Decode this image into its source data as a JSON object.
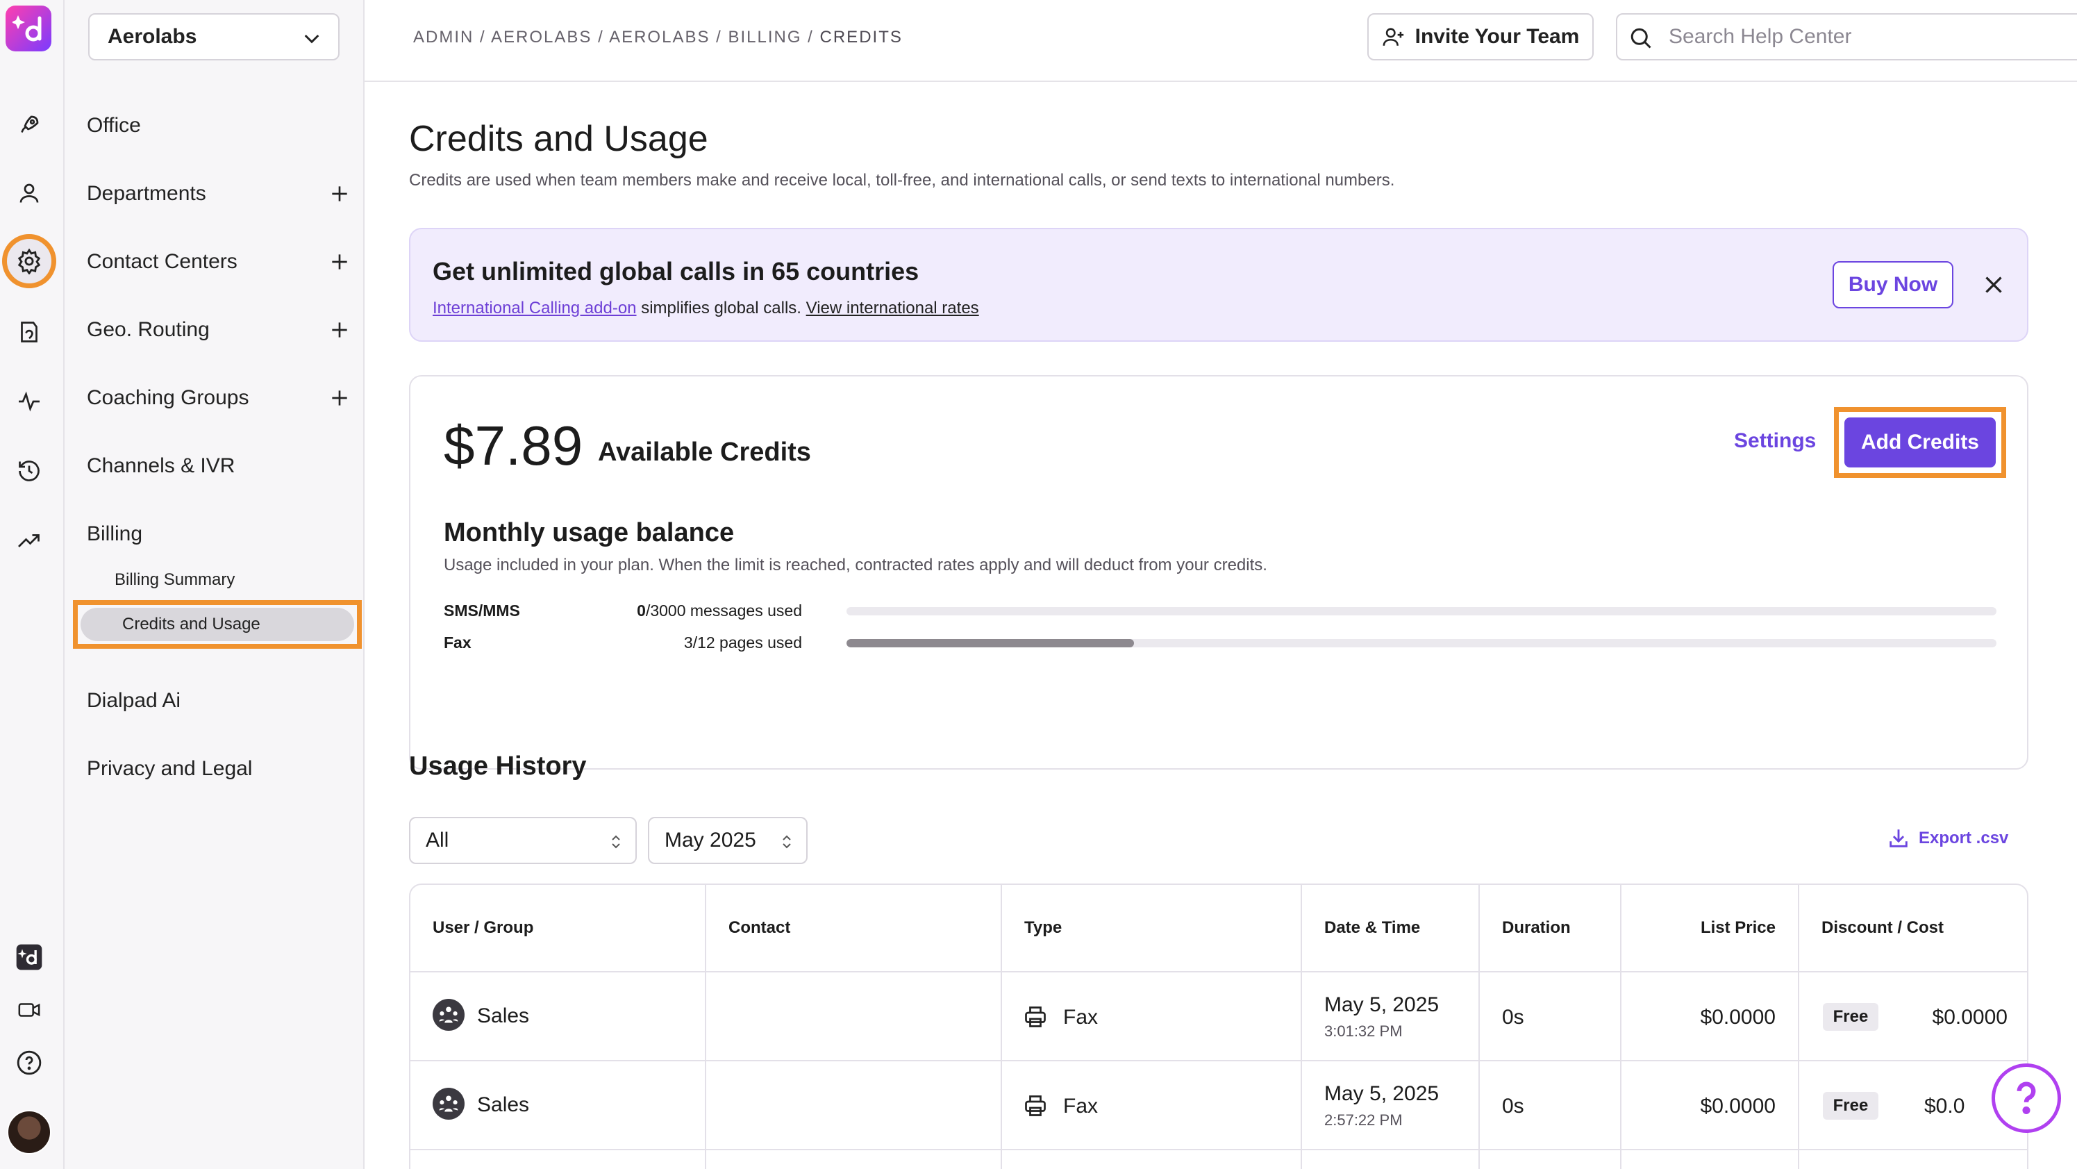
{
  "org_select": {
    "value": "Aerolabs"
  },
  "breadcrumb": {
    "path": "ADMIN / AEROLABS / AEROLABS / BILLING / ",
    "current": "CREDITS"
  },
  "topbar": {
    "invite_label": "Invite Your Team",
    "search_placeholder": "Search Help Center"
  },
  "sidebar": {
    "items": [
      {
        "label": "Office"
      },
      {
        "label": "Departments"
      },
      {
        "label": "Contact Centers"
      },
      {
        "label": "Geo. Routing"
      },
      {
        "label": "Coaching Groups"
      },
      {
        "label": "Channels & IVR"
      },
      {
        "label": "Billing"
      },
      {
        "label": "Dialpad Ai"
      },
      {
        "label": "Privacy and Legal"
      }
    ],
    "billing_sub": [
      {
        "label": "Billing Summary"
      },
      {
        "label": "Credits and Usage",
        "active": true
      }
    ]
  },
  "page": {
    "title": "Credits and Usage",
    "subtitle": "Credits are used when team members make and receive local, toll-free, and international calls, or send texts to international numbers."
  },
  "promo": {
    "title": "Get unlimited global calls in 65 countries",
    "link1": "International Calling add-on",
    "text": " simplifies global calls. ",
    "link2": "View international rates",
    "buy_label": "Buy Now"
  },
  "credits": {
    "amount": "$7.89",
    "label": "Available Credits",
    "settings_label": "Settings",
    "add_label": "Add Credits",
    "usage_title": "Monthly usage balance",
    "usage_sub": "Usage included in your plan. When the limit is reached, contracted rates apply and will deduct from your credits.",
    "rows": [
      {
        "label": "SMS/MMS",
        "used": "0",
        "rest": "/3000 messages used",
        "fraction": 0.0
      },
      {
        "label": "Fax",
        "used": "3/12",
        "rest": " pages used",
        "fraction": 0.25
      }
    ]
  },
  "history": {
    "title": "Usage History",
    "filter_value": "All",
    "month_value": "May 2025",
    "export_label": "Export .csv",
    "columns": [
      "User / Group",
      "Contact",
      "Type",
      "Date & Time",
      "Duration",
      "List Price",
      "Discount / Cost"
    ],
    "rows": [
      {
        "user": "Sales",
        "contact": "",
        "type": "Fax",
        "date": "May 5, 2025",
        "time": "3:01:32 PM",
        "duration": "0s",
        "list_price": "$0.0000",
        "discount": "Free",
        "cost": "$0.0000"
      },
      {
        "user": "Sales",
        "contact": "",
        "type": "Fax",
        "date": "May 5, 2025",
        "time": "2:57:22 PM",
        "duration": "0s",
        "list_price": "$0.0000",
        "discount": "Free",
        "cost": "$0.0"
      }
    ]
  },
  "colors": {
    "accent": "#6b45e0",
    "highlight": "#f0922e",
    "promo_bg": "#f1ecfd"
  },
  "icons": [
    "dialpad-logo-icon",
    "rocket-icon",
    "person-icon",
    "gear-icon",
    "directory-icon",
    "activity-icon",
    "history-icon",
    "trend-icon",
    "dialpad-ai-icon",
    "video-icon",
    "help-icon",
    "chevron-down-icon",
    "plus-icon",
    "person-add-icon",
    "search-icon",
    "close-icon",
    "download-icon",
    "updown-chevron-icon",
    "printer-icon"
  ]
}
